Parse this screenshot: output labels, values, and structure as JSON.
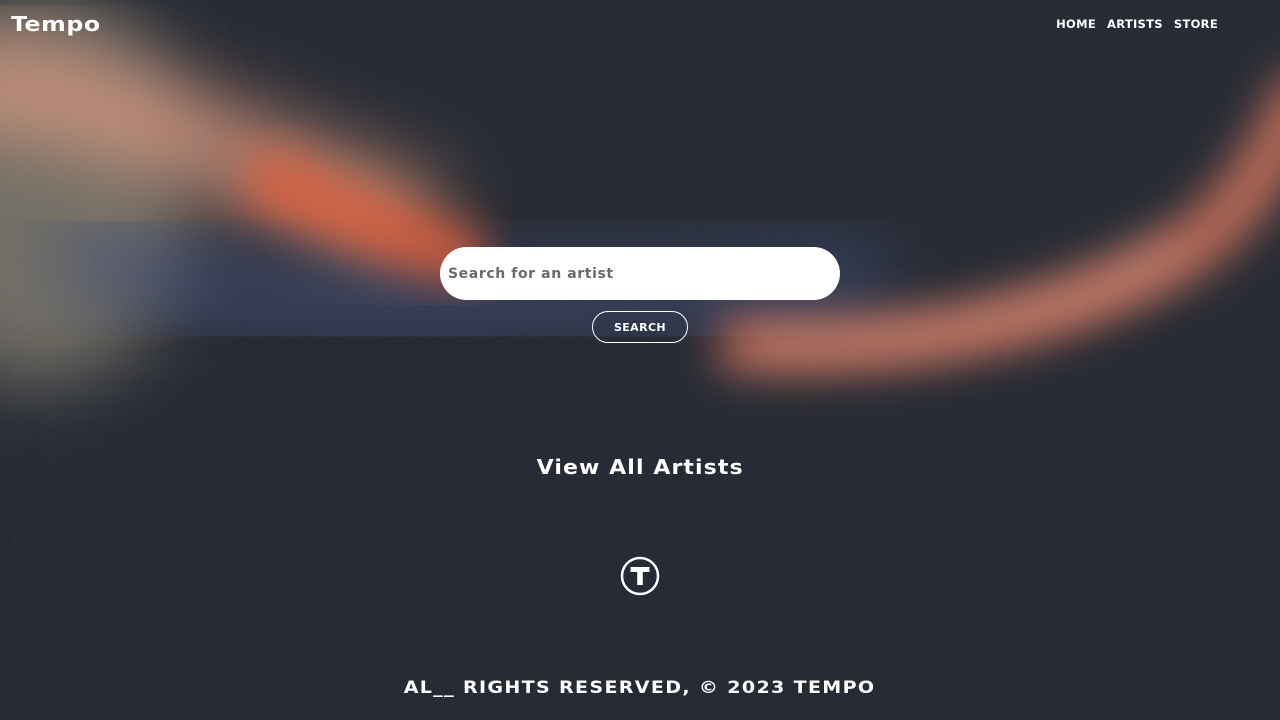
{
  "header": {
    "logo": "Tempo",
    "nav": [
      "HOME",
      "ARTISTS",
      "STORE"
    ]
  },
  "search": {
    "placeholder": "Search for an artist",
    "button_label": "SEARCH"
  },
  "view_all_label": "View All Artists",
  "brand_mark": {
    "letter": "T",
    "icon": "tempo-t-logo-icon"
  },
  "footer": {
    "text": "AL__ RIGHTS RESERVED, © 2023 TEMPO"
  },
  "colors": {
    "background": "#1f232d",
    "accent_orange": "#e0613d",
    "accent_peach": "#e8a287",
    "accent_blue": "#3b4a6e",
    "text": "#ffffff"
  }
}
